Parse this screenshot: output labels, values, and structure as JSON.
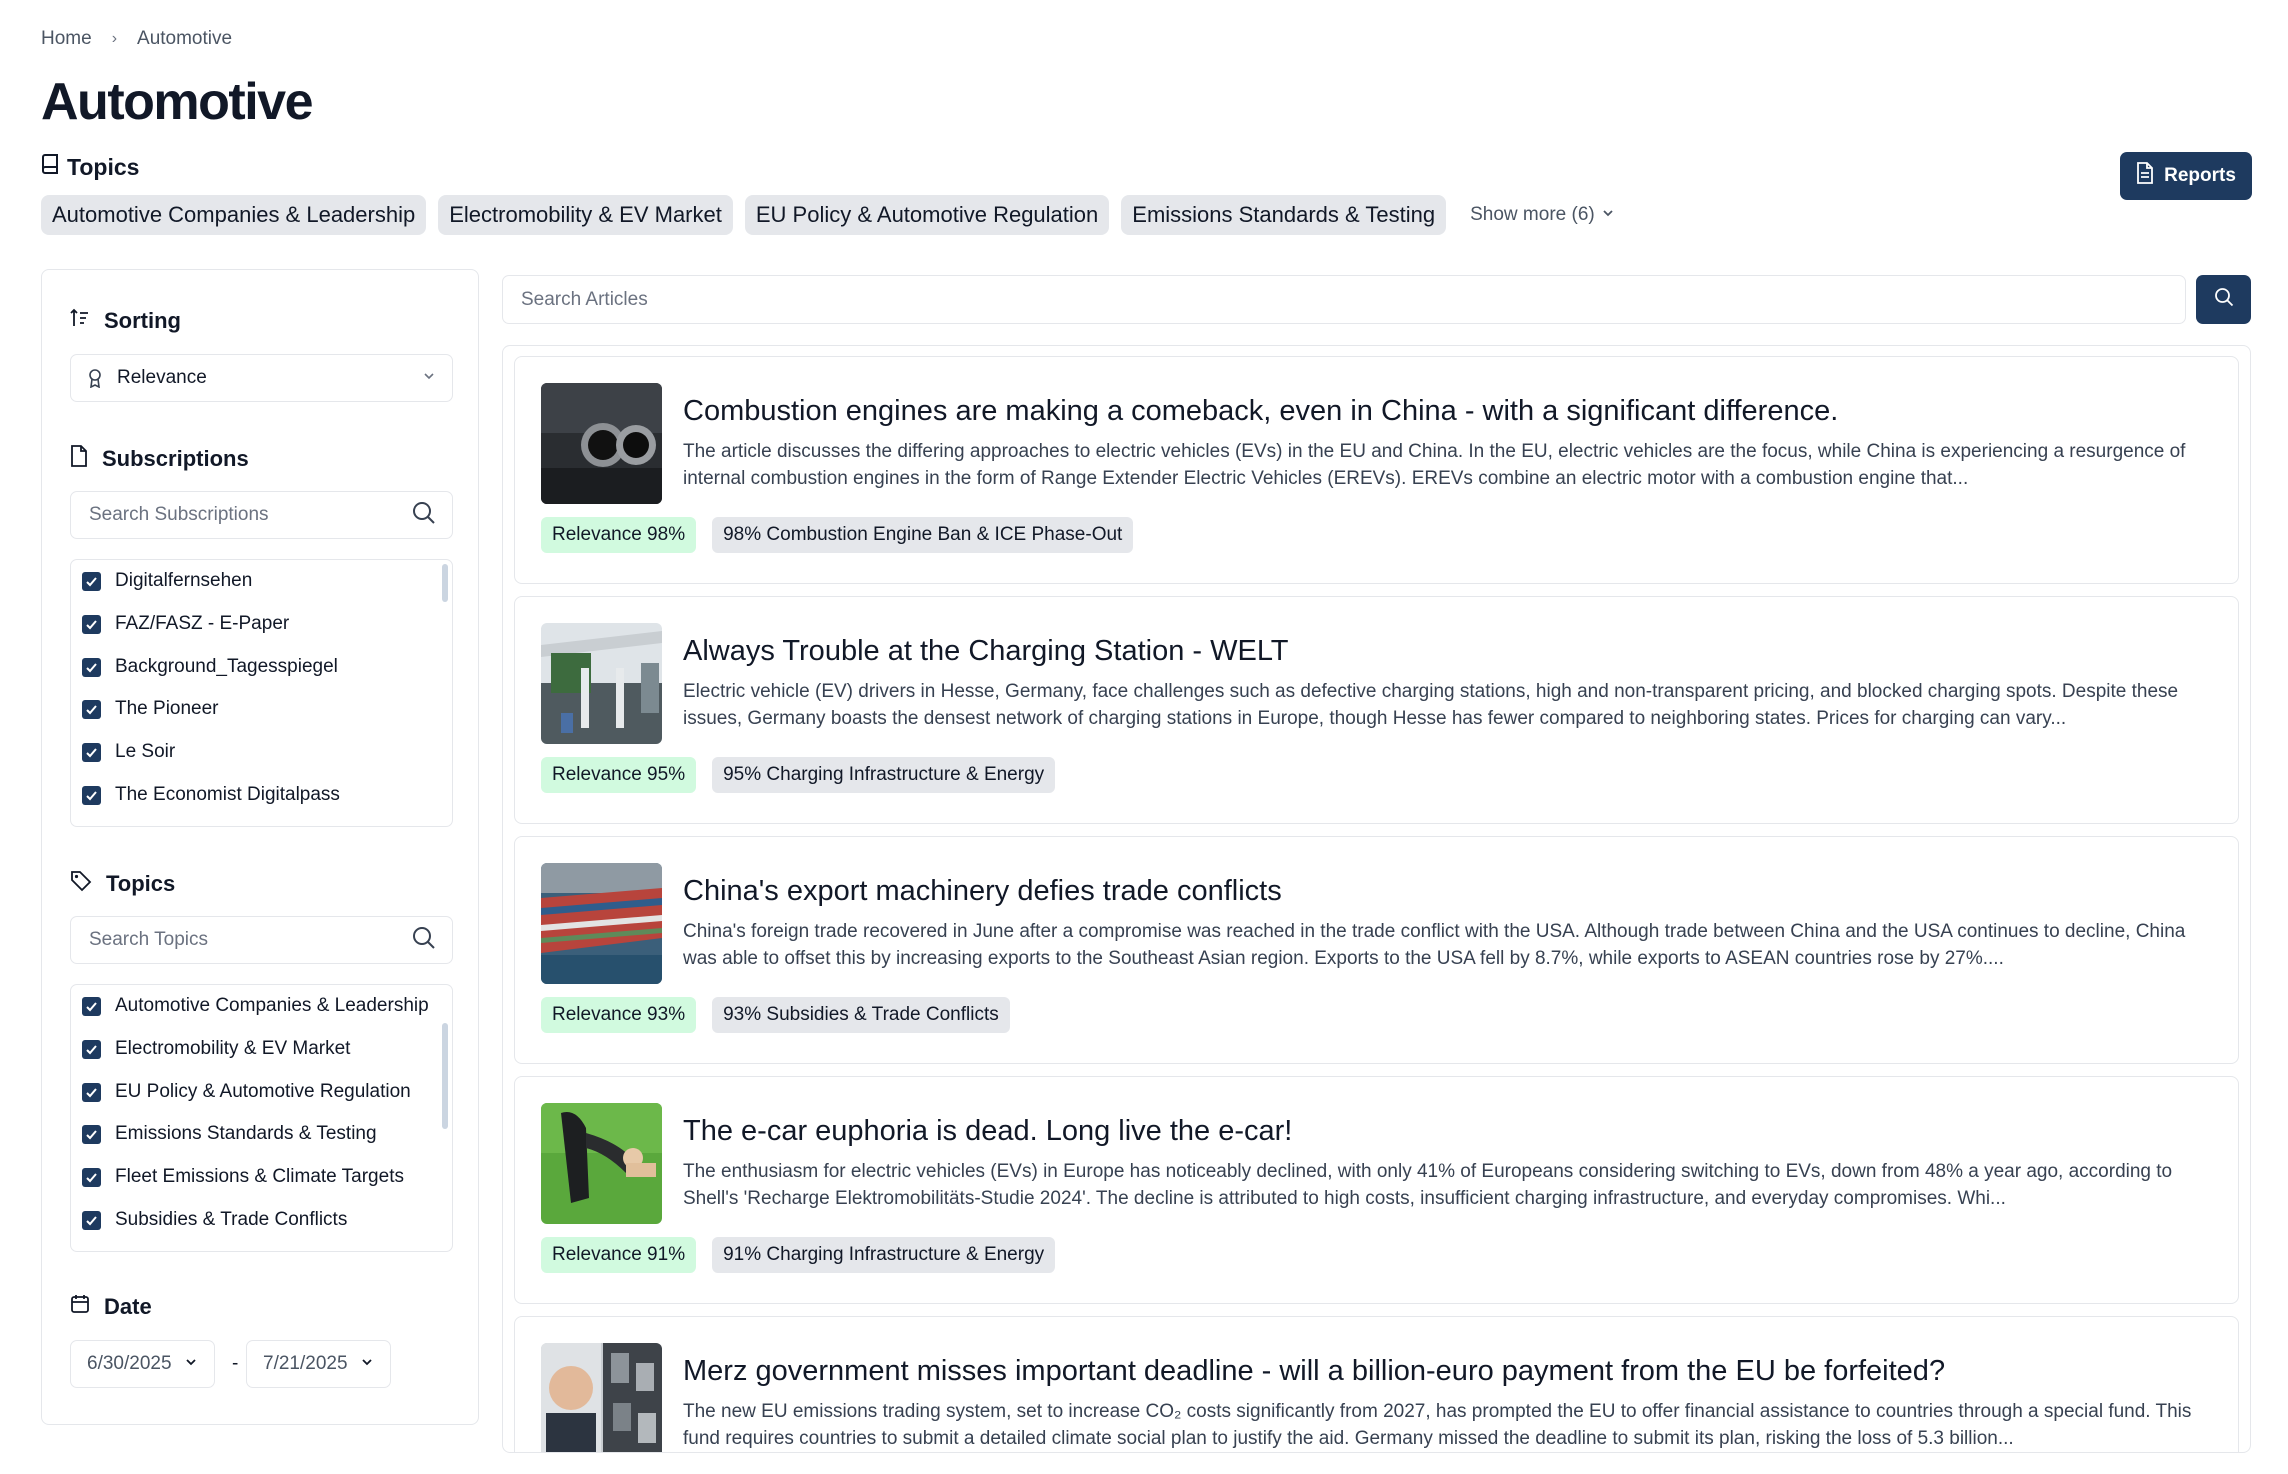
{
  "breadcrumb": {
    "home": "Home",
    "separator": "›",
    "current": "Automotive"
  },
  "page_title": "Automotive",
  "topics_header": {
    "label": "Topics",
    "chips": [
      "Automotive Companies & Leadership",
      "Electromobility & EV Market",
      "EU Policy & Automotive Regulation",
      "Emissions Standards & Testing"
    ],
    "show_more": "Show more (6)"
  },
  "reports_button": "Reports",
  "sidebar": {
    "sorting": {
      "title": "Sorting",
      "selected": "Relevance"
    },
    "subscriptions": {
      "title": "Subscriptions",
      "search_placeholder": "Search Subscriptions",
      "items": [
        {
          "label": "Digitalfernsehen",
          "checked": true
        },
        {
          "label": "FAZ/FASZ - E-Paper",
          "checked": true
        },
        {
          "label": "Background_Tagesspiegel",
          "checked": true
        },
        {
          "label": "The Pioneer",
          "checked": true
        },
        {
          "label": "Le Soir",
          "checked": true
        },
        {
          "label": "The Economist Digitalpass",
          "checked": true
        }
      ]
    },
    "topics": {
      "title": "Topics",
      "search_placeholder": "Search Topics",
      "items": [
        {
          "label": "Automotive Companies & Leadership",
          "checked": true
        },
        {
          "label": "Electromobility & EV Market",
          "checked": true
        },
        {
          "label": "EU Policy & Automotive Regulation",
          "checked": true
        },
        {
          "label": "Emissions Standards & Testing",
          "checked": true
        },
        {
          "label": "Fleet Emissions & Climate Targets",
          "checked": true
        },
        {
          "label": "Subsidies & Trade Conflicts",
          "checked": true
        }
      ]
    },
    "date": {
      "title": "Date",
      "from": "6/30/2025",
      "separator": "-",
      "to": "7/21/2025"
    }
  },
  "search_articles": {
    "placeholder": "Search Articles"
  },
  "articles": [
    {
      "title": "Combustion engines are making a comeback, even in China - with a significant difference.",
      "summary": "The article discusses the differing approaches to electric vehicles (EVs) in the EU and China. In the EU, electric vehicles are the focus, while China is experiencing a resurgence of internal combustion engines in the form of Range Extender Electric Vehicles (EREVs). EREVs combine an electric motor with a combustion engine that...",
      "relevance": "Relevance 98%",
      "topic_badge": "98% Combustion Engine Ban & ICE Phase-Out",
      "thumb": "exhaust-pipes"
    },
    {
      "title": "Always Trouble at the Charging Station - WELT",
      "summary": "Electric vehicle (EV) drivers in Hesse, Germany, face challenges such as defective charging stations, high and non-transparent pricing, and blocked charging spots. Despite these issues, Germany boasts the densest network of charging stations in Europe, though Hesse has fewer compared to neighboring states. Prices for charging can vary...",
      "relevance": "Relevance 95%",
      "topic_badge": "95% Charging Infrastructure & Energy",
      "thumb": "charging-station"
    },
    {
      "title": "China's export machinery defies trade conflicts",
      "summary": "China's foreign trade recovered in June after a compromise was reached in the trade conflict with the USA. Although trade between China and the USA continues to decline, China was able to offset this by increasing exports to the Southeast Asian region. Exports to the USA fell by 8.7%, while exports to ASEAN countries rose by 27%....",
      "relevance": "Relevance 93%",
      "topic_badge": "93% Subsidies & Trade Conflicts",
      "thumb": "container-port"
    },
    {
      "title": "The e-car euphoria is dead. Long live the e-car!",
      "summary": "The enthusiasm for electric vehicles (EVs) in Europe has noticeably declined, with only 41% of Europeans considering switching to EVs, down from 48% a year ago, according to Shell's 'Recharge Elektromobilitäts-Studie 2024'. The decline is attributed to high costs, insufficient charging infrastructure, and everyday compromises. Whi...",
      "relevance": "Relevance 91%",
      "topic_badge": "91% Charging Infrastructure & Energy",
      "thumb": "charging-plug"
    },
    {
      "title": "Merz government misses important deadline - will a billion-euro payment from the EU be forfeited?",
      "summary": "The new EU emissions trading system, set to increase CO₂ costs significantly from 2027, has prompted the EU to offer financial assistance to countries through a special fund. This fund requires countries to submit a detailed climate social plan to justify the aid. Germany missed the deadline to submit its plan, risking the loss of 5.3 billion...",
      "relevance": "",
      "topic_badge": "",
      "thumb": "politician-traffic"
    }
  ]
}
